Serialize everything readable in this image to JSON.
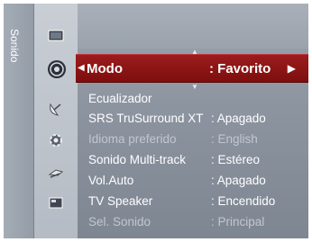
{
  "sidebar": {
    "tab_label": "Sonido"
  },
  "icons": [
    "picture-icon",
    "sound-icon",
    "satellite-dish-icon",
    "gear-icon",
    "input-icon",
    "app-icon"
  ],
  "menu": {
    "selected": {
      "label": "Modo",
      "value": ": Favorito"
    },
    "items": [
      {
        "label": "Ecualizador",
        "value": "",
        "enabled": true
      },
      {
        "label": "SRS TruSurround XT",
        "value": ": Apagado",
        "enabled": true
      },
      {
        "label": "Idioma preferido",
        "value": ": English",
        "enabled": false
      },
      {
        "label": "Sonido Multi-track",
        "value": ": Estéreo",
        "enabled": true
      },
      {
        "label": "Vol.Auto",
        "value": ": Apagado",
        "enabled": true
      },
      {
        "label": "TV Speaker",
        "value": ": Encendido",
        "enabled": true
      },
      {
        "label": "Sel. Sonido",
        "value": ": Principal",
        "enabled": false
      }
    ]
  },
  "colors": {
    "selection": "#8b1414",
    "background": "#8e96a1",
    "disabled_text": "#c2c7cf"
  }
}
